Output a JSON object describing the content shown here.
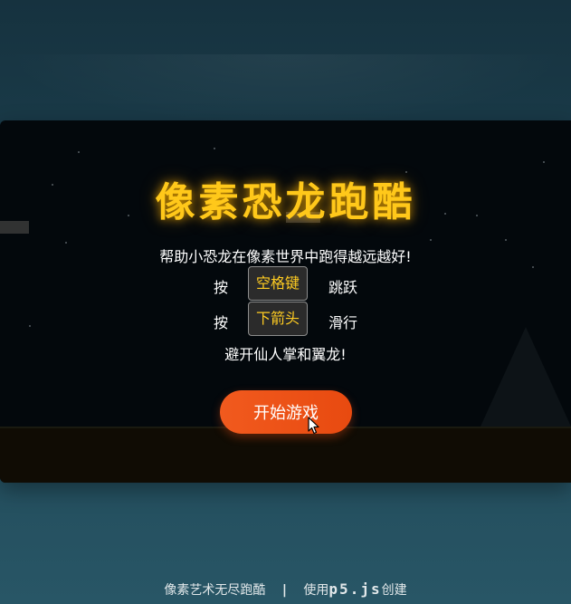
{
  "game": {
    "title": "像素恐龙跑酷",
    "intro": "帮助小恐龙在像素世界中跑得越远越好!",
    "controls": [
      {
        "prefix": "按",
        "key": "空格键",
        "action": "跳跃"
      },
      {
        "prefix": "按",
        "key": "下箭头",
        "action": "滑行"
      }
    ],
    "avoid": "避开仙人掌和翼龙!",
    "start_label": "开始游戏"
  },
  "footer": {
    "left_text": "像素艺术无尽跑酷",
    "separator": "|",
    "made_with_prefix": "使用",
    "library": "p5.js",
    "made_with_suffix": "创建"
  },
  "colors": {
    "title": "#ffc81a",
    "key_text": "#ffcc22",
    "start_button": "#ee5318",
    "canvas_bg": "#03080c",
    "ground": "#100c04",
    "page_bg": "#1f4655"
  },
  "icons": {
    "cursor": "mouse-pointer-icon"
  }
}
